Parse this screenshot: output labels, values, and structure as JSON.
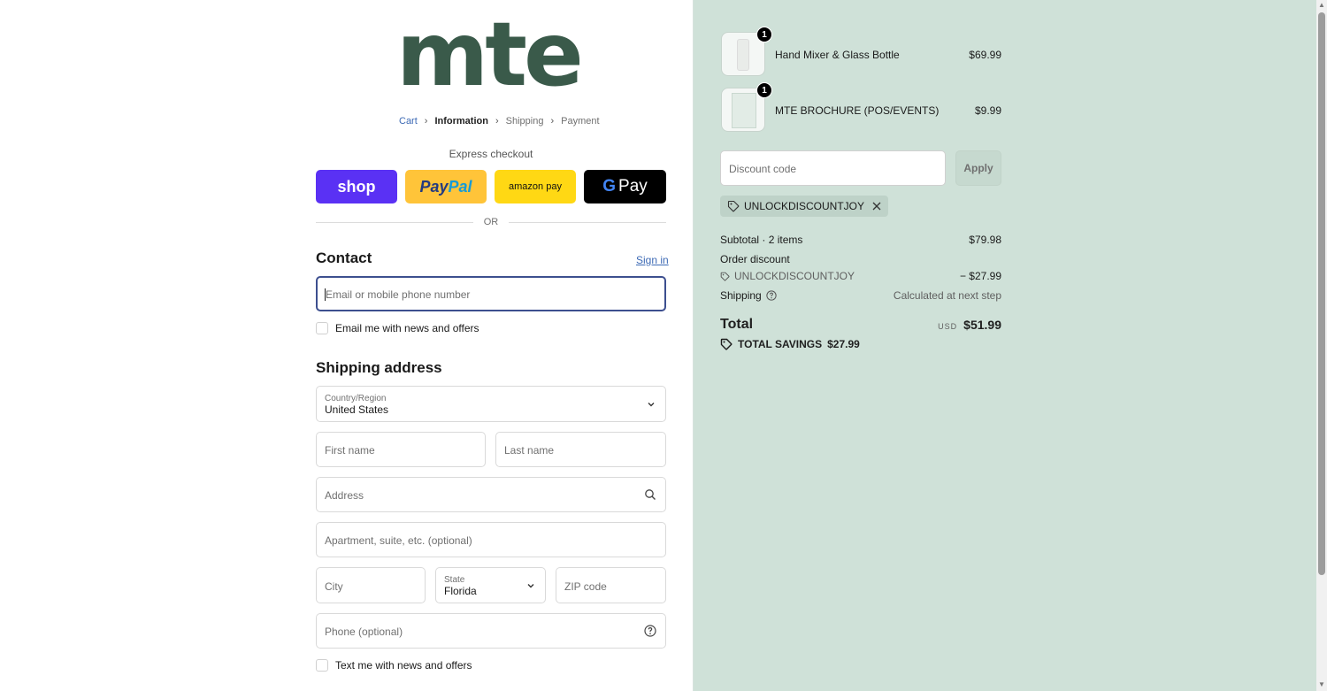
{
  "brand": {
    "logo_text": "mte"
  },
  "breadcrumb": {
    "cart": "Cart",
    "information": "Information",
    "shipping": "Shipping",
    "payment": "Payment",
    "separator": "›"
  },
  "express": {
    "title": "Express checkout",
    "shop": "shop",
    "paypal_pay": "Pay",
    "paypal_pal": "Pal",
    "amazon": "amazon pay",
    "gpay_g": "G",
    "gpay_text": "Pay",
    "or": "OR"
  },
  "contact": {
    "title": "Contact",
    "signin": "Sign in",
    "email_placeholder": "Email or mobile phone number",
    "email_news": "Email me with news and offers"
  },
  "shipping_address": {
    "title": "Shipping address",
    "country_label": "Country/Region",
    "country_value": "United States",
    "first_name": "First name",
    "last_name": "Last name",
    "address": "Address",
    "apartment": "Apartment, suite, etc. (optional)",
    "city": "City",
    "state_label": "State",
    "state_value": "Florida",
    "zip": "ZIP code",
    "phone": "Phone (optional)",
    "text_news": "Text me with news and offers"
  },
  "cart": {
    "items": [
      {
        "qty": "1",
        "name": "Hand Mixer & Glass Bottle",
        "price": "$69.99"
      },
      {
        "qty": "1",
        "name": "MTE BROCHURE (POS/EVENTS)",
        "price": "$9.99"
      }
    ],
    "discount_placeholder": "Discount code",
    "apply": "Apply",
    "applied_code": "UNLOCKDISCOUNTJOY"
  },
  "summary": {
    "subtotal_label": "Subtotal · 2 items",
    "subtotal_value": "$79.98",
    "order_discount_label": "Order discount",
    "discount_code": "UNLOCKDISCOUNTJOY",
    "discount_value": "− $27.99",
    "shipping_label": "Shipping",
    "shipping_value": "Calculated at next step",
    "total_label": "Total",
    "currency": "USD",
    "total_value": "$51.99",
    "savings_label": "TOTAL SAVINGS",
    "savings_value": "$27.99"
  },
  "colors": {
    "accent": "#3d6ab5",
    "brand": "#3a5a4a",
    "summary_bg": "#cfe1d8",
    "shop_purple": "#5a31f4",
    "paypal_yellow": "#ffc439",
    "amazon_yellow": "#ffd814"
  }
}
